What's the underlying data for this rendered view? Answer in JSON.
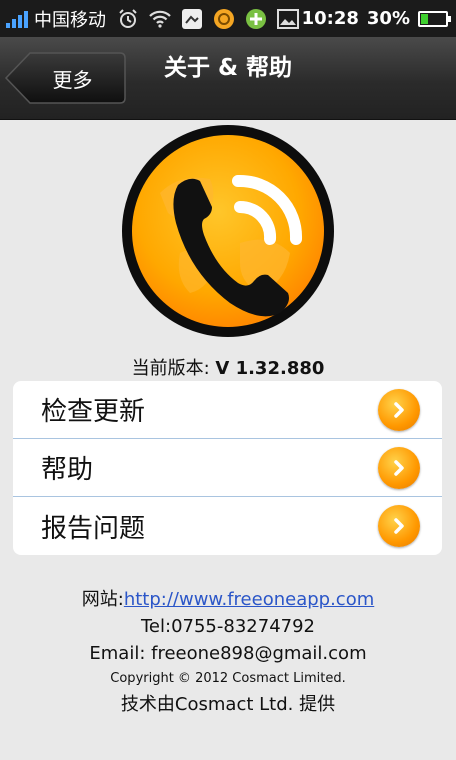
{
  "status_bar": {
    "carrier": "中国移动",
    "time": "10:28",
    "battery_percent": "30%",
    "battery_level": 0.3,
    "icons": [
      "alarm-icon",
      "wifi-icon",
      "app-icon",
      "coin-icon",
      "plus-app-icon",
      "image-icon"
    ]
  },
  "header": {
    "back_label": "更多",
    "title": "关于 & 帮助"
  },
  "version": {
    "label": "当前版本: ",
    "value": "V 1.32.880"
  },
  "menu": {
    "items": [
      {
        "label": "检查更新"
      },
      {
        "label": "帮助"
      },
      {
        "label": "报告问题"
      }
    ]
  },
  "footer": {
    "website_label": "网站:",
    "website_url": "http://www.freeoneapp.com",
    "tel": "Tel:0755-83274792",
    "email": "Email: freeone898@gmail.com",
    "copyright": "Copyright © 2012 Cosmact Limited.",
    "powered_by": "技术由Cosmact Ltd. 提供"
  },
  "colors": {
    "accent_orange": "#ff9800",
    "link": "#2b56c8",
    "divider": "#a9c4e0"
  }
}
